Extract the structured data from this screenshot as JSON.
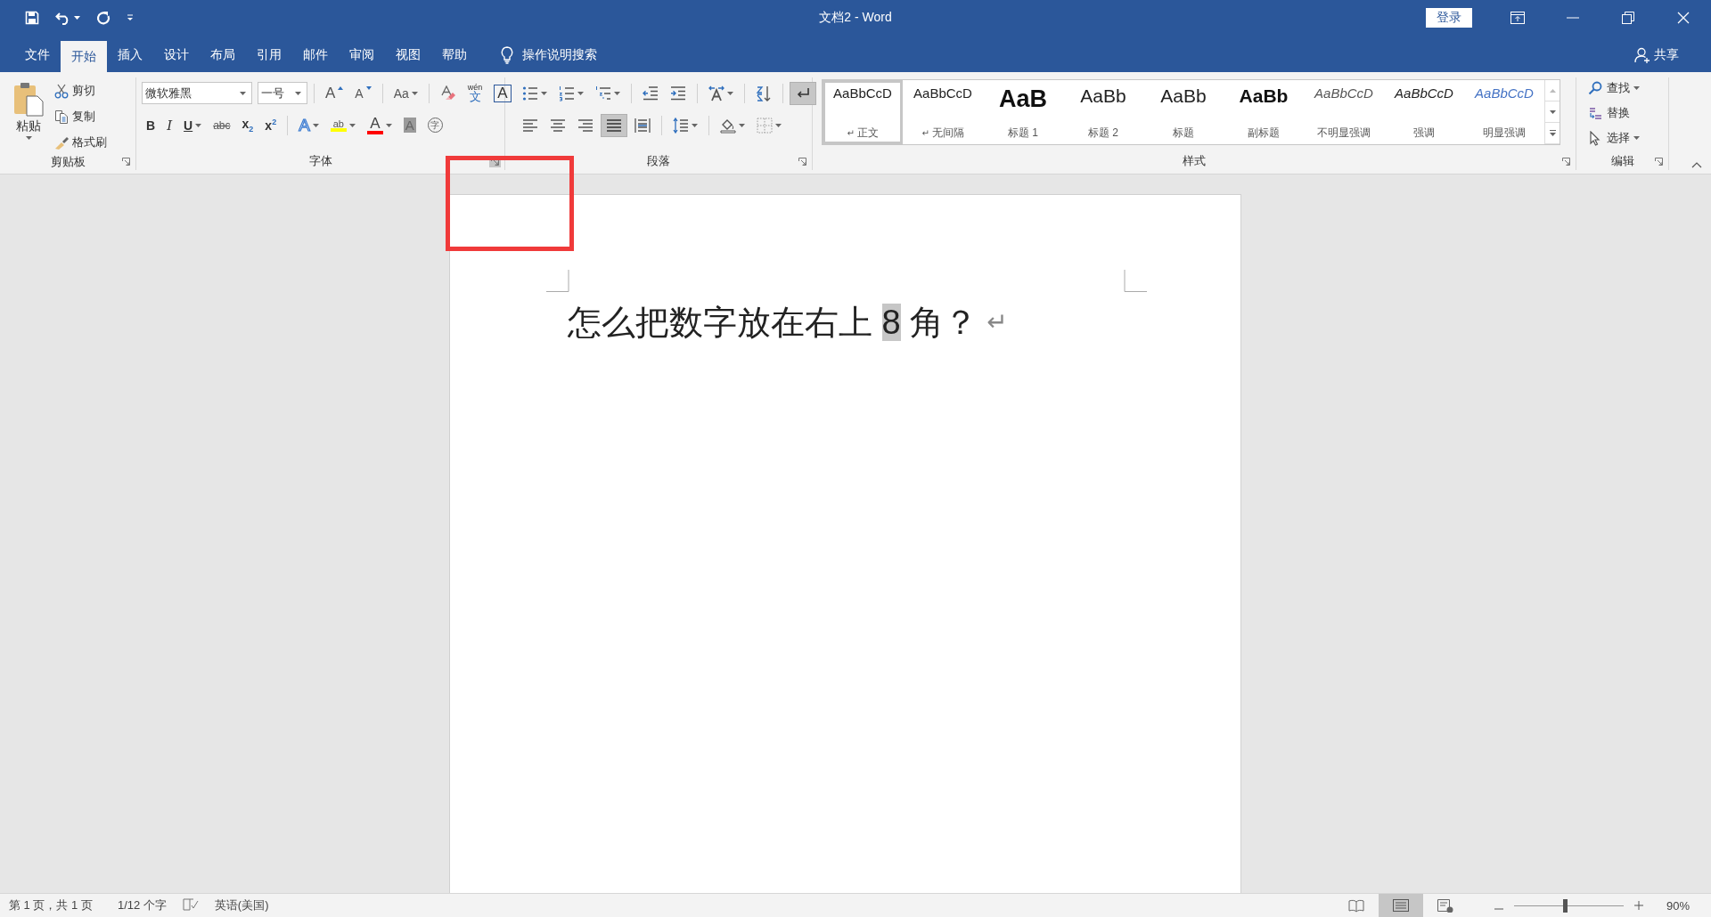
{
  "window": {
    "title": "文档2 - Word",
    "sign_in": "登录"
  },
  "tabs": [
    {
      "label": "文件",
      "selected": false
    },
    {
      "label": "开始",
      "selected": true
    },
    {
      "label": "插入",
      "selected": false
    },
    {
      "label": "设计",
      "selected": false
    },
    {
      "label": "布局",
      "selected": false
    },
    {
      "label": "引用",
      "selected": false
    },
    {
      "label": "邮件",
      "selected": false
    },
    {
      "label": "审阅",
      "selected": false
    },
    {
      "label": "视图",
      "selected": false
    },
    {
      "label": "帮助",
      "selected": false
    }
  ],
  "tell_me": "操作说明搜索",
  "share": "共享",
  "ribbon": {
    "clipboard": {
      "label": "剪贴板",
      "paste": "粘贴",
      "items": [
        {
          "kind": "cut",
          "label": "剪切"
        },
        {
          "kind": "copy",
          "label": "复制"
        },
        {
          "kind": "painter",
          "label": "格式刷"
        }
      ]
    },
    "font": {
      "label": "字体",
      "launcher_hover": true,
      "name": "微软雅黑",
      "size": "一号",
      "row1": [
        {
          "kind": "grow",
          "glyph": "A",
          "dropdown": false
        },
        {
          "kind": "shrink",
          "glyph": "A",
          "dropdown": false
        },
        {
          "kind": "case",
          "glyph": "Aa",
          "dropdown": true
        },
        {
          "kind": "clear",
          "dropdown": false
        },
        {
          "kind": "phonetic",
          "ruby": "wén",
          "glyph": "文",
          "dropdown": false
        },
        {
          "kind": "border",
          "glyph": "A",
          "dropdown": false
        }
      ],
      "row2": [
        {
          "kind": "bold",
          "glyph": "B",
          "dropdown": false
        },
        {
          "kind": "italic",
          "glyph": "I",
          "dropdown": false
        },
        {
          "kind": "underline",
          "glyph": "U",
          "dropdown": true
        },
        {
          "kind": "strike",
          "glyph": "abc",
          "dropdown": false
        },
        {
          "kind": "sub",
          "glyph": "x$_{2}$",
          "dropdown": false
        },
        {
          "kind": "sup",
          "glyph": "x$^{2}$",
          "dropdown": false
        },
        {
          "kind": "effects",
          "glyph": "A",
          "dropdown": true
        },
        {
          "kind": "highlight",
          "glyph": "ab",
          "color": "#ffff00",
          "dropdown": true
        },
        {
          "kind": "color",
          "glyph": "A",
          "color": "#ff0000",
          "dropdown": true
        },
        {
          "kind": "shading",
          "glyph": "A",
          "dropdown": false
        },
        {
          "kind": "enclose",
          "glyph": "字",
          "dropdown": false
        }
      ]
    },
    "paragraph": {
      "label": "段落",
      "row1": [
        {
          "kind": "bullets",
          "dropdown": true,
          "selected": false
        },
        {
          "kind": "numbering",
          "dropdown": true,
          "selected": false
        },
        {
          "kind": "multilevel",
          "dropdown": true,
          "selected": false
        },
        {
          "kind": "outdent",
          "dropdown": false,
          "selected": false
        },
        {
          "kind": "indent",
          "dropdown": false,
          "selected": false
        },
        {
          "kind": "asian",
          "dropdown": true,
          "selected": false
        },
        {
          "kind": "sort",
          "dropdown": false,
          "selected": false
        },
        {
          "kind": "marks",
          "dropdown": false,
          "selected": true
        }
      ],
      "row2": [
        {
          "kind": "left",
          "dropdown": false,
          "selected": false
        },
        {
          "kind": "center",
          "dropdown": false,
          "selected": false
        },
        {
          "kind": "right",
          "dropdown": false,
          "selected": false
        },
        {
          "kind": "justify",
          "dropdown": false,
          "selected": true
        },
        {
          "kind": "distributed",
          "dropdown": false,
          "selected": false
        },
        {
          "kind": "spacing",
          "dropdown": true,
          "selected": false
        },
        {
          "kind": "shading",
          "dropdown": true,
          "selected": false
        },
        {
          "kind": "borders",
          "dropdown": true,
          "selected": false
        }
      ]
    },
    "styles": {
      "label": "样式",
      "items": [
        {
          "kind": "normal",
          "sample": "AaBbCcD",
          "name": "正文",
          "mark": "↵",
          "selected": true
        },
        {
          "kind": "normal",
          "sample": "AaBbCcD",
          "name": "无间隔",
          "mark": "↵",
          "selected": false
        },
        {
          "kind": "heading1",
          "sample": "AaB",
          "name": "标题 1",
          "selected": false
        },
        {
          "kind": "heading2",
          "sample": "AaBb",
          "name": "标题 2",
          "selected": false
        },
        {
          "kind": "heading2",
          "sample": "AaBb",
          "name": "标题",
          "selected": false
        },
        {
          "kind": "subtitle",
          "sample": "AaBb",
          "name": "副标题",
          "selected": false
        },
        {
          "kind": "subtle",
          "sample": "AaBbCcD",
          "name": "不明显强调",
          "selected": false
        },
        {
          "kind": "emphasis",
          "sample": "AaBbCcD",
          "name": "强调",
          "selected": false
        },
        {
          "kind": "intense",
          "sample": "AaBbCcD",
          "name": "明显强调",
          "selected": false
        }
      ]
    },
    "editing": {
      "label": "编辑",
      "items": [
        {
          "kind": "find",
          "label": "查找",
          "dropdown": true
        },
        {
          "kind": "replace",
          "label": "替换",
          "dropdown": false
        },
        {
          "kind": "select",
          "label": "选择",
          "dropdown": true
        }
      ]
    }
  },
  "document": {
    "runs": [
      {
        "text": "怎么把数字放在右上 ",
        "selected": false
      },
      {
        "text": "8",
        "selected": true
      },
      {
        "text": " 角？",
        "selected": false
      }
    ],
    "paragraph_mark": "↵"
  },
  "status_bar": {
    "page": "第 1 页，共 1 页",
    "words": "1/12 个字",
    "language": "英语(美国)",
    "views": [
      {
        "kind": "read",
        "selected": false
      },
      {
        "kind": "print",
        "selected": true
      },
      {
        "kind": "web",
        "selected": false
      }
    ],
    "zoom": {
      "level": 0.46,
      "reading": "90%"
    }
  },
  "annotations": [
    {
      "kind": "rectangle"
    }
  ]
}
